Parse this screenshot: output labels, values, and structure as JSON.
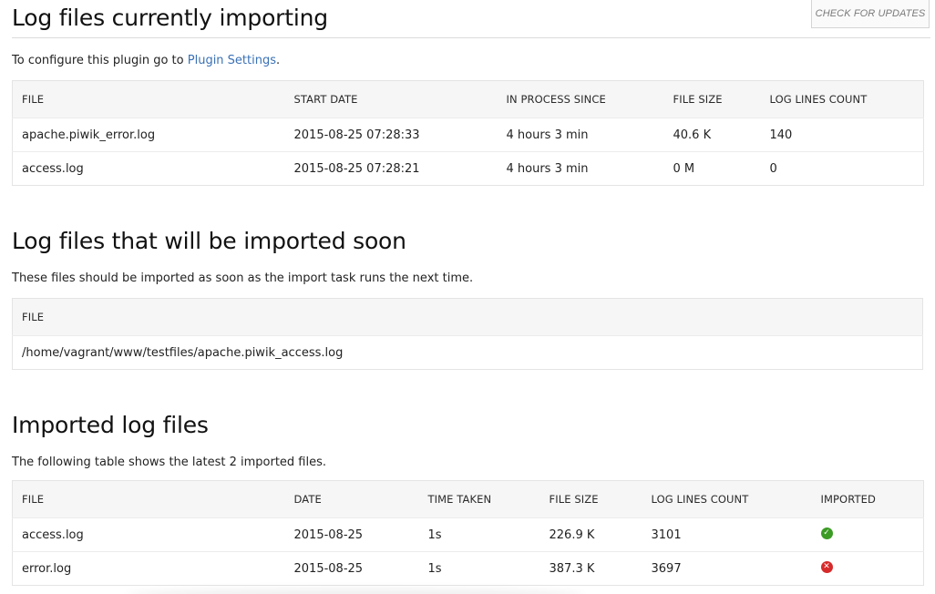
{
  "header": {
    "check_updates_label": "CHECK FOR UPDATES"
  },
  "importing": {
    "title": "Log files currently importing",
    "desc_prefix": "To configure this plugin go to ",
    "desc_link": "Plugin Settings",
    "desc_suffix": ".",
    "columns": [
      "FILE",
      "START DATE",
      "IN PROCESS SINCE",
      "FILE SIZE",
      "LOG LINES COUNT"
    ],
    "rows": [
      {
        "file": "apache.piwik_error.log",
        "start_date": "2015-08-25 07:28:33",
        "in_process": "4 hours 3 min",
        "size": "40.6 K",
        "lines": "140"
      },
      {
        "file": "access.log",
        "start_date": "2015-08-25 07:28:21",
        "in_process": "4 hours 3 min",
        "size": "0 M",
        "lines": "0"
      }
    ]
  },
  "soon": {
    "title": "Log files that will be imported soon",
    "desc": "These files should be imported as soon as the import task runs the next time.",
    "columns": [
      "FILE"
    ],
    "rows": [
      {
        "file": "/home/vagrant/www/testfiles/apache.piwik_access.log"
      }
    ]
  },
  "imported": {
    "title": "Imported log files",
    "desc": "The following table shows the latest 2 imported files.",
    "columns": [
      "FILE",
      "DATE",
      "TIME TAKEN",
      "FILE SIZE",
      "LOG LINES COUNT",
      "IMPORTED"
    ],
    "rows": [
      {
        "file": "access.log",
        "date": "2015-08-25",
        "time_taken": "1s",
        "size": "226.9 K",
        "lines": "3101",
        "status": "success",
        "status_icon": "check-circle-icon",
        "status_glyph": "✓"
      },
      {
        "file": "error.log",
        "date": "2015-08-25",
        "time_taken": "1s",
        "size": "387.3 K",
        "lines": "3697",
        "status": "error",
        "status_icon": "cross-circle-icon",
        "status_glyph": "✕"
      }
    ],
    "colors": {
      "success": "#3b9b25",
      "error": "#d62a2a"
    }
  }
}
